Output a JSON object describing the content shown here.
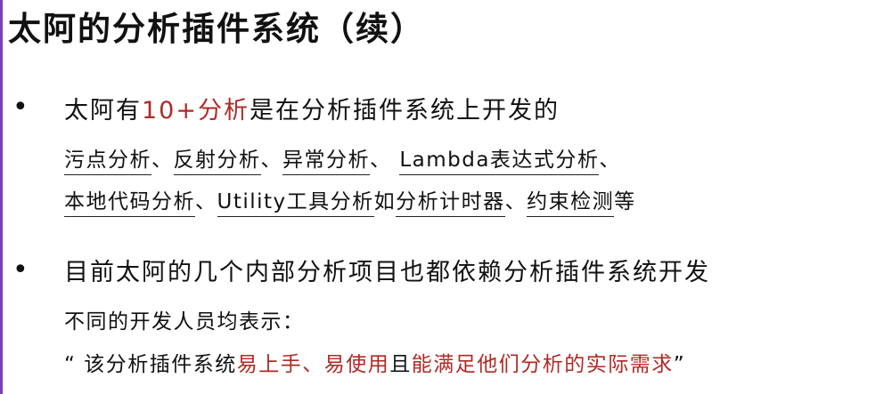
{
  "slide": {
    "title": "太阿的分析插件系统（续）",
    "bullet_char": "•",
    "b1": {
      "prefix": "太阿有",
      "highlight": "10+分析",
      "suffix": "是在分析插件系统上开发的",
      "l2": {
        "t1": "污点分析",
        "s1": "、",
        "t2": "反射分析",
        "s2": "、",
        "t3": "异常分析",
        "s3": "、 ",
        "t4": "Lambda表达式分析",
        "s4": "、"
      },
      "l3": {
        "t1": "本地代码分析",
        "s1": "、",
        "t2": "Utility工具分析",
        "s2": "如",
        "t3": "分析计时器",
        "s3": "、",
        "t4": "约束检测",
        "s4": "等"
      }
    },
    "b2": {
      "text": "目前太阿的几个内部分析项目也都依赖分析插件系统开发",
      "sub": "不同的开发人员均表示：",
      "quote": {
        "open": "“ ",
        "p1": "该分析插件系统",
        "r1": "易上手、易使用",
        "p2": "且",
        "r2": "能满足他们分析的实际需求",
        "close": "”"
      }
    }
  }
}
